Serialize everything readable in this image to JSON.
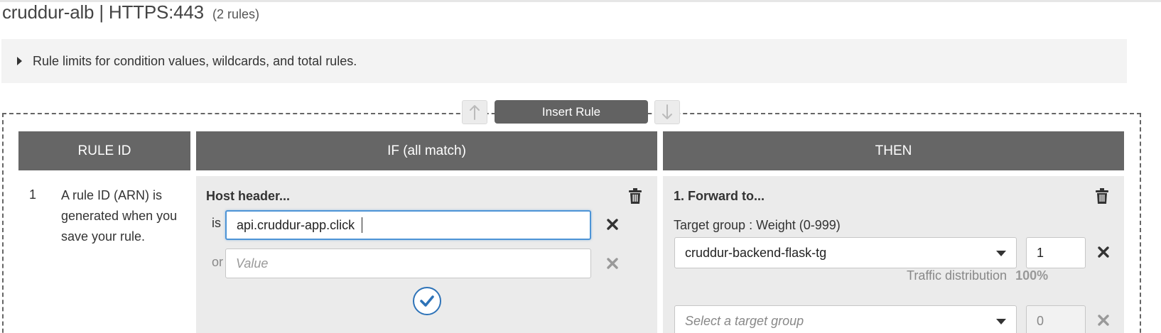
{
  "header": {
    "title": "cruddur-alb | HTTPS:443",
    "rule_count": "(2 rules)"
  },
  "info": {
    "text": "Rule limits for condition values, wildcards, and total rules."
  },
  "toolbar": {
    "insert_rule_label": "Insert Rule"
  },
  "columns": {
    "rule_id": "RULE ID",
    "if": "IF (all match)",
    "then": "THEN"
  },
  "rule": {
    "number": "1",
    "description": "A rule ID (ARN) is generated when you save your rule."
  },
  "condition": {
    "title": "Host header...",
    "is_label": "is",
    "is_value": "api.cruddur-app.click",
    "or_label": "or",
    "or_placeholder": "Value"
  },
  "action": {
    "title": "1. Forward to...",
    "target_group_label": "Target group : Weight (0-999)",
    "targets": [
      {
        "group": "cruddur-backend-flask-tg",
        "weight": "1"
      },
      {
        "group": "Select a target group",
        "weight": "0"
      }
    ],
    "traffic_label": "Traffic distribution",
    "traffic_value": "100%"
  },
  "colors": {
    "header_bg": "#666666",
    "panel_bg": "#ebebeb",
    "focus_border": "#4d94d6",
    "confirm_blue": "#2e73b8"
  },
  "icons": [
    "triangle-right-icon",
    "arrow-up-icon",
    "arrow-down-icon",
    "trash-icon",
    "close-icon",
    "check-circle-icon",
    "chevron-down-icon"
  ]
}
